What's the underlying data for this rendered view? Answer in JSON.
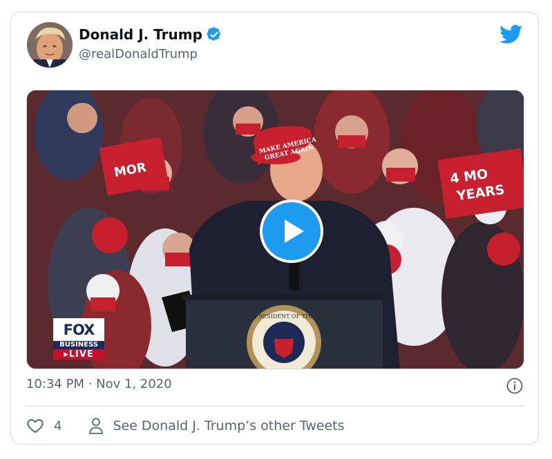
{
  "tweet": {
    "display_name": "Donald J. Trump",
    "handle": "@realDonaldTrump",
    "timestamp": "10:34 PM · Nov 1, 2020",
    "like_count": "4",
    "other_tweets_label": "See Donald J. Trump’s other Tweets"
  },
  "media": {
    "hat_text_line1": "MAKE AMERICA",
    "hat_text_line2": "GREAT AGAIN",
    "sign_text_line1": "4 MO",
    "sign_text_line2": "YEARS",
    "sign_left_text": "MOR",
    "seal_text": "PRESIDENT OF THE UNITED",
    "fox_logo": "FOX",
    "fox_sub": "BUSINESS",
    "fox_live": "▸LIVE"
  },
  "colors": {
    "accent": "#1d9bf0",
    "text_secondary": "#536471",
    "border": "#cfd9de"
  },
  "icons": [
    "verified-badge-icon",
    "twitter-bird-icon",
    "play-icon",
    "info-icon",
    "heart-icon",
    "person-icon"
  ]
}
